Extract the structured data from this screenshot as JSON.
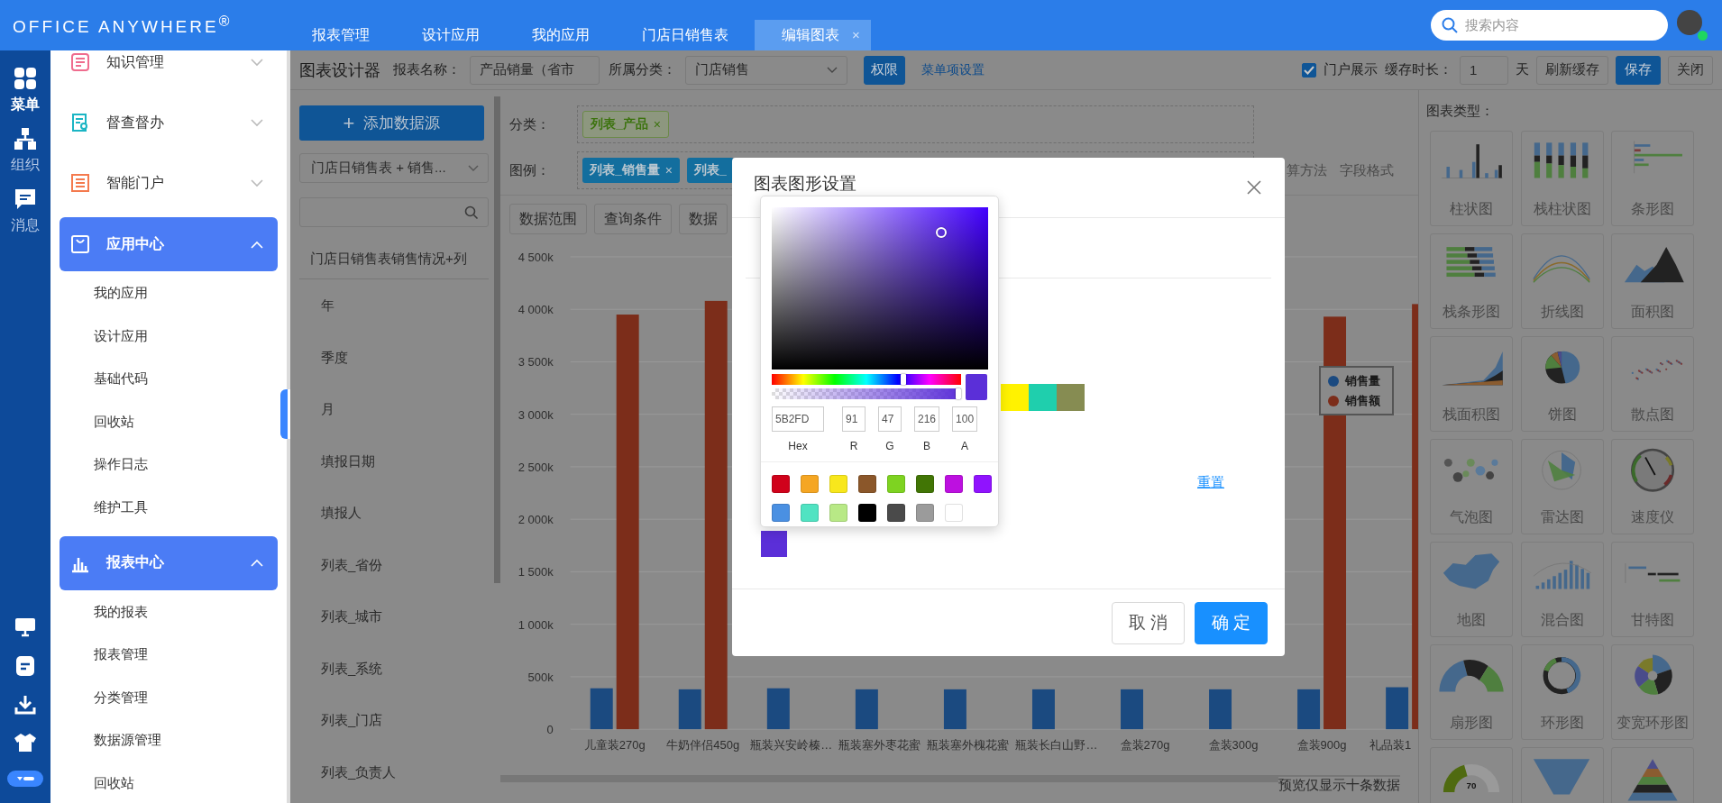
{
  "topbar": {
    "logo": "OFFICE ANYWHERE$^{®}$",
    "tabs": [
      {
        "label": "报表管理",
        "selected": false
      },
      {
        "label": "设计应用",
        "selected": false
      },
      {
        "label": "我的应用",
        "selected": false
      },
      {
        "label": "门店日销售表",
        "selected": false
      },
      {
        "label": "编辑图表",
        "selected": true,
        "close": "×"
      }
    ],
    "search": {
      "placeholder": "搜索内容"
    },
    "user": {
      "online": true
    }
  },
  "rail": {
    "items": [
      {
        "label": "菜单",
        "kind": "grid",
        "selected": true
      },
      {
        "label": "组织",
        "kind": "org",
        "selected": false
      },
      {
        "label": "消息",
        "kind": "chat",
        "selected": false
      }
    ],
    "tools": [
      {
        "kind": "monitor"
      },
      {
        "kind": "doc"
      },
      {
        "kind": "download"
      },
      {
        "kind": "shirt"
      },
      {
        "kind": "toggle"
      }
    ]
  },
  "menu": [
    {
      "label": "知识管理",
      "kind": "knowledge",
      "expanded": false
    },
    {
      "label": "督查督办",
      "kind": "supervise",
      "expanded": false
    },
    {
      "label": "智能门户",
      "kind": "portal",
      "expanded": false
    },
    {
      "label": "应用中心",
      "kind": "app",
      "expanded": true,
      "children": [
        "我的应用",
        "设计应用",
        "基础代码",
        "回收站",
        "操作日志",
        "维护工具"
      ]
    },
    {
      "label": "报表中心",
      "kind": "report",
      "expanded": true,
      "children": [
        "我的报表",
        "报表管理",
        "分类管理",
        "数据源管理",
        "回收站"
      ]
    }
  ],
  "toolbar": {
    "title": "图表设计器",
    "name_label": "报表名称：",
    "name_value": "产品销量（省市",
    "category_label": "所属分类：",
    "category_value": "门店销售",
    "permission_button": "权限",
    "menu_link": "菜单项设置",
    "portal": {
      "label": "门户展示",
      "checked": true
    },
    "cache_label": "缓存时长：",
    "cache_value": "1",
    "cache_unit": "天",
    "buttons": [
      {
        "label": "刷新缓存",
        "primary": false
      },
      {
        "label": "保存",
        "primary": true
      },
      {
        "label": "关闭",
        "primary": false
      }
    ]
  },
  "datasource": {
    "add_icon": "+",
    "add_label": "添加数据源",
    "select": "门店日销售表 + 销售...",
    "header": "门店日销售表销售情况+列",
    "fields": [
      "年",
      "季度",
      "月",
      "填报日期",
      "填报人",
      "列表_省份",
      "列表_城市",
      "列表_系统",
      "列表_门店",
      "列表_负责人"
    ]
  },
  "designer": {
    "category": {
      "label": "分类：",
      "tags": [
        {
          "label": "列表_产品",
          "close": "×"
        }
      ]
    },
    "legend": {
      "label": "图例：",
      "tags": [
        {
          "label": "列表_销售量",
          "close": "×"
        },
        {
          "label": "列表_"
        }
      ],
      "actions": [
        "算方法",
        "字段格式"
      ]
    },
    "buttons": [
      "数据范围",
      "查询条件",
      "数据"
    ],
    "chart_data": {
      "type": "bar",
      "categories": [
        "儿童装270g",
        "牛奶伴侣450g",
        "瓶装兴安岭榛…",
        "瓶装塞外枣花蜜",
        "瓶装塞外槐花蜜",
        "瓶装长白山野…",
        "盒装270g",
        "盒装300g",
        "盒装900g",
        "礼品装1"
      ],
      "series": [
        {
          "name": "销售量",
          "color": "#1b4a80",
          "values": [
            390000,
            380000,
            390000,
            380000,
            380000,
            380000,
            380000,
            380000,
            380000,
            400000
          ]
        },
        {
          "name": "销售额",
          "color": "#7c2d1a",
          "values": [
            3950000,
            4080000,
            null,
            null,
            null,
            null,
            null,
            null,
            3930000,
            4050000
          ]
        }
      ],
      "ylim": [
        0,
        4500000
      ],
      "grid": true,
      "legend": true,
      "yticks": [
        {
          "value": 0,
          "label": "0"
        },
        {
          "value": 500000,
          "label": "500k"
        },
        {
          "value": 1000000,
          "label": "1 000k"
        },
        {
          "value": 1500000,
          "label": "1 500k"
        },
        {
          "value": 2000000,
          "label": "2 000k"
        },
        {
          "value": 2500000,
          "label": "2 500k"
        },
        {
          "value": 3000000,
          "label": "3 000k"
        },
        {
          "value": 3500000,
          "label": "3 500k"
        },
        {
          "value": 4000000,
          "label": "4 000k"
        },
        {
          "value": 4500000,
          "label": "4 500k"
        }
      ]
    },
    "note": "预览仅显示十条数据"
  },
  "chart_types": {
    "title": "图表类型：",
    "items": [
      {
        "label": "柱状图",
        "kind": "bar"
      },
      {
        "label": "栈柱状图",
        "kind": "stacked"
      },
      {
        "label": "条形图",
        "kind": "hbar"
      },
      {
        "label": "栈条形图",
        "kind": "stackedhbar"
      },
      {
        "label": "折线图",
        "kind": "line"
      },
      {
        "label": "面积图",
        "kind": "area"
      },
      {
        "label": "栈面积图",
        "kind": "stackedarea"
      },
      {
        "label": "饼图",
        "kind": "pie"
      },
      {
        "label": "散点图",
        "kind": "scatter"
      },
      {
        "label": "气泡图",
        "kind": "bubble"
      },
      {
        "label": "雷达图",
        "kind": "radar"
      },
      {
        "label": "速度仪",
        "kind": "gauge"
      },
      {
        "label": "地图",
        "kind": "map"
      },
      {
        "label": "混合图",
        "kind": "mixed"
      },
      {
        "label": "甘特图",
        "kind": "gantt"
      },
      {
        "label": "扇形图",
        "kind": "fan"
      },
      {
        "label": "环形图",
        "kind": "ring"
      },
      {
        "label": "变宽环形图",
        "kind": "rose"
      },
      {
        "kind": "halfgauge",
        "value": "70"
      },
      {
        "kind": "funnel"
      },
      {
        "kind": "pyramid"
      }
    ]
  },
  "dialog": {
    "title": "图表图形设置",
    "swatches": [
      {
        "color": "#fff200"
      },
      {
        "color": "#1fcfad"
      },
      {
        "color": "#868c52"
      }
    ],
    "reset_link": "重置",
    "buttons": [
      {
        "label": "取 消",
        "primary": false
      },
      {
        "label": "确 定",
        "primary": true
      }
    ],
    "picker": {
      "hue": {
        "level": 0.71
      },
      "alpha": {
        "level": 1
      },
      "hex": "5B2FD",
      "r": "91",
      "g": "47",
      "b": "216",
      "a": "100",
      "labels": [
        "Hex",
        "R",
        "G",
        "B",
        "A"
      ],
      "presets": [
        {
          "color": "#d0021b"
        },
        {
          "color": "#f5a623"
        },
        {
          "color": "#f8e71c"
        },
        {
          "color": "#8b572a"
        },
        {
          "color": "#7ed321"
        },
        {
          "color": "#417505"
        },
        {
          "color": "#bd10e0"
        },
        {
          "color": "#9013fe"
        },
        {
          "color": "#4a90e2"
        },
        {
          "color": "#50e3c2"
        },
        {
          "color": "#b8e986"
        },
        {
          "color": "#000000"
        },
        {
          "color": "#4a4a4a"
        },
        {
          "color": "#9b9b9b"
        },
        {
          "color": "#ffffff"
        }
      ]
    }
  }
}
